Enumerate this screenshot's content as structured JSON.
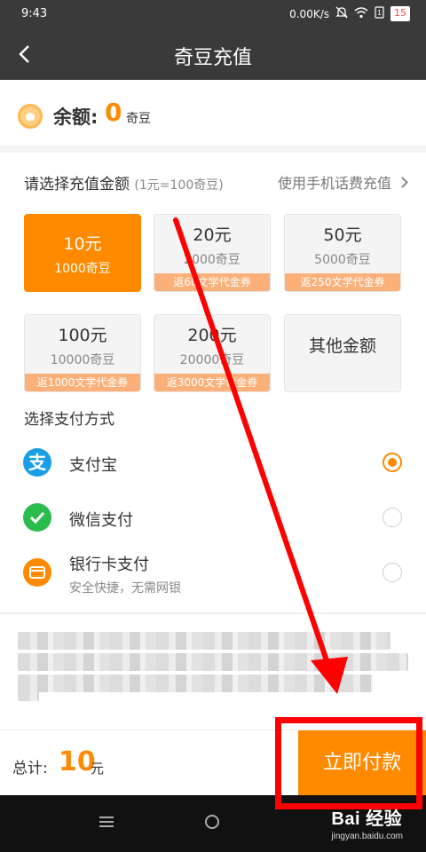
{
  "status_bar": {
    "time": "9:43",
    "speed": "0.00K/s",
    "battery": "15"
  },
  "header": {
    "title": "奇豆充值"
  },
  "balance": {
    "label": "余额:",
    "value": "0",
    "unit": "奇豆"
  },
  "recharge": {
    "label": "请选择充值金额",
    "rate_note": "(1元=100奇豆)",
    "phone_link": "使用手机话费充值",
    "options": [
      {
        "price": "10元",
        "beans": "1000奇豆",
        "coupon": "",
        "selected": true
      },
      {
        "price": "20元",
        "beans": "2000奇豆",
        "coupon": "返60文学代金券",
        "selected": false
      },
      {
        "price": "50元",
        "beans": "5000奇豆",
        "coupon": "返250文学代金券",
        "selected": false
      },
      {
        "price": "100元",
        "beans": "10000奇豆",
        "coupon": "返1000文学代金券",
        "selected": false
      },
      {
        "price": "200元",
        "beans": "20000奇豆",
        "coupon": "返3000文学代金券",
        "selected": false
      }
    ],
    "other_amount": "其他金额"
  },
  "payment": {
    "label": "选择支付方式",
    "methods": [
      {
        "name": "支付宝",
        "subtitle": "",
        "icon": "alipay-icon",
        "color": "#1a9ee8",
        "selected": true
      },
      {
        "name": "微信支付",
        "subtitle": "",
        "icon": "wechat-pay-icon",
        "color": "#2bbc4e",
        "selected": false
      },
      {
        "name": "银行卡支付",
        "subtitle": "安全快捷，无需网银",
        "icon": "bank-card-icon",
        "color": "#ff8a00",
        "selected": false
      }
    ]
  },
  "footer": {
    "total_label": "总计:",
    "total_value": "10",
    "total_unit": "元",
    "pay_button": "立即付款"
  },
  "watermark": {
    "main": "Bai 经验",
    "sub": "jingyan.baidu.com"
  },
  "colors": {
    "accent": "#ff8a00",
    "header_bg": "#3a3a3a",
    "annotation": "#ff0000"
  }
}
